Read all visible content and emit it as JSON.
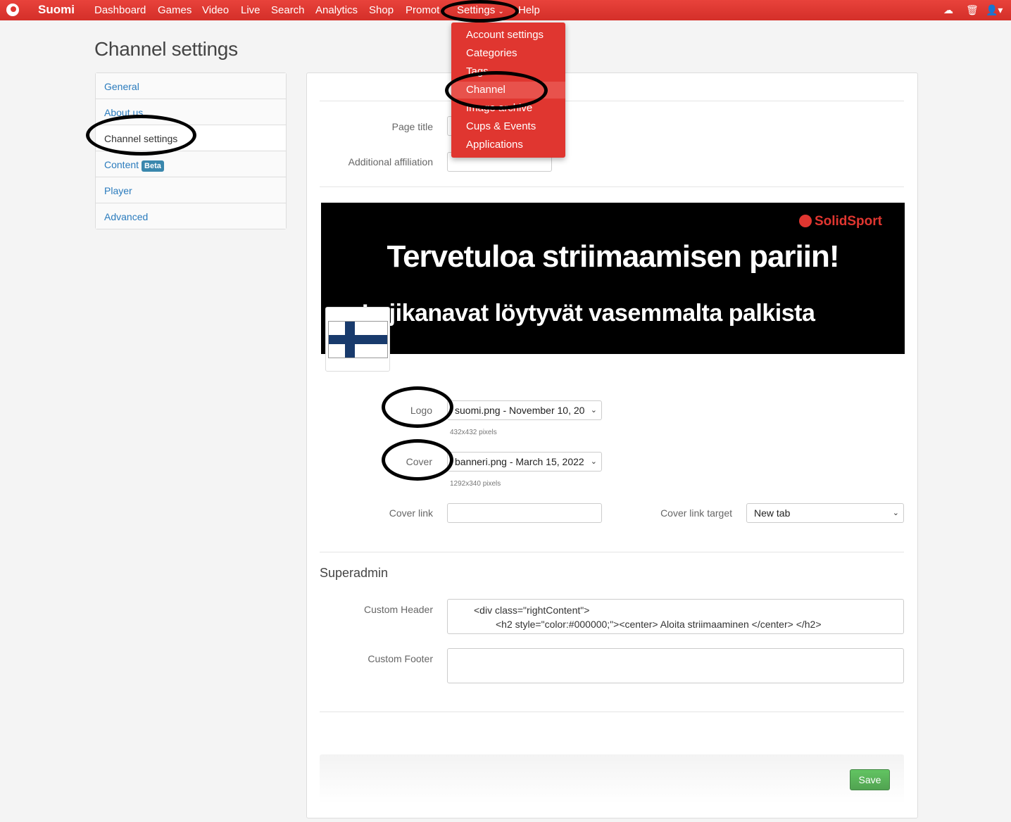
{
  "navbar": {
    "brand": "Suomi",
    "items": [
      "Dashboard",
      "Games",
      "Video",
      "Live",
      "Search",
      "Analytics",
      "Shop",
      "Promot",
      "Settings",
      "Help"
    ],
    "right_icons": [
      "cloud-upload-icon",
      "trash-icon",
      "user-icon"
    ]
  },
  "settings_menu": {
    "items": [
      "Account settings",
      "Categories",
      "Tags",
      "Channel",
      "Image archive",
      "Cups & Events",
      "Applications"
    ],
    "visible_texts": [
      "Account settings",
      "Categories",
      "Tags",
      "Channel",
      "Image archive",
      "Cups & Events",
      "Applications"
    ],
    "active": "Channel"
  },
  "page": {
    "title": "Channel settings"
  },
  "sidebar": {
    "items": [
      {
        "label": "General"
      },
      {
        "label": "About us"
      },
      {
        "label": "Channel settings"
      },
      {
        "label": "Content",
        "badge": "Beta"
      },
      {
        "label": "Player"
      },
      {
        "label": "Advanced"
      }
    ],
    "active": "Channel settings"
  },
  "form": {
    "page_title_label": "Page title",
    "page_title_value": "",
    "affiliation_label": "Additional affiliation",
    "affiliation_value": "",
    "logo_label": "Logo",
    "logo_value": "suomi.png - November 10, 20",
    "logo_help": "432x432 pixels",
    "cover_label": "Cover",
    "cover_value": "banneri.png - March 15, 2022",
    "cover_help": "1292x340 pixels",
    "cover_link_label": "Cover link",
    "cover_link_value": "",
    "cover_link_target_label": "Cover link target",
    "cover_link_target_value": "New tab"
  },
  "banner": {
    "brand": "SolidSport",
    "headline": "Tervetuloa striimaamisen pariin!",
    "subline": "Lajikanavat löytyvät vasemmalta palkista"
  },
  "superadmin": {
    "title": "Superadmin",
    "custom_header_label": "Custom Header",
    "custom_header_line1": "<div class=\"rightContent\">",
    "custom_header_line2": "<h2 style=\"color:#000000;\"><center> Aloita striimaaminen </center> </h2>",
    "custom_footer_label": "Custom Footer",
    "custom_footer_value": ""
  },
  "actions": {
    "save_label": "Save"
  },
  "colors": {
    "brand_red": "#e03630",
    "link_blue": "#2a7bbd",
    "save_green": "#5cb85c"
  }
}
